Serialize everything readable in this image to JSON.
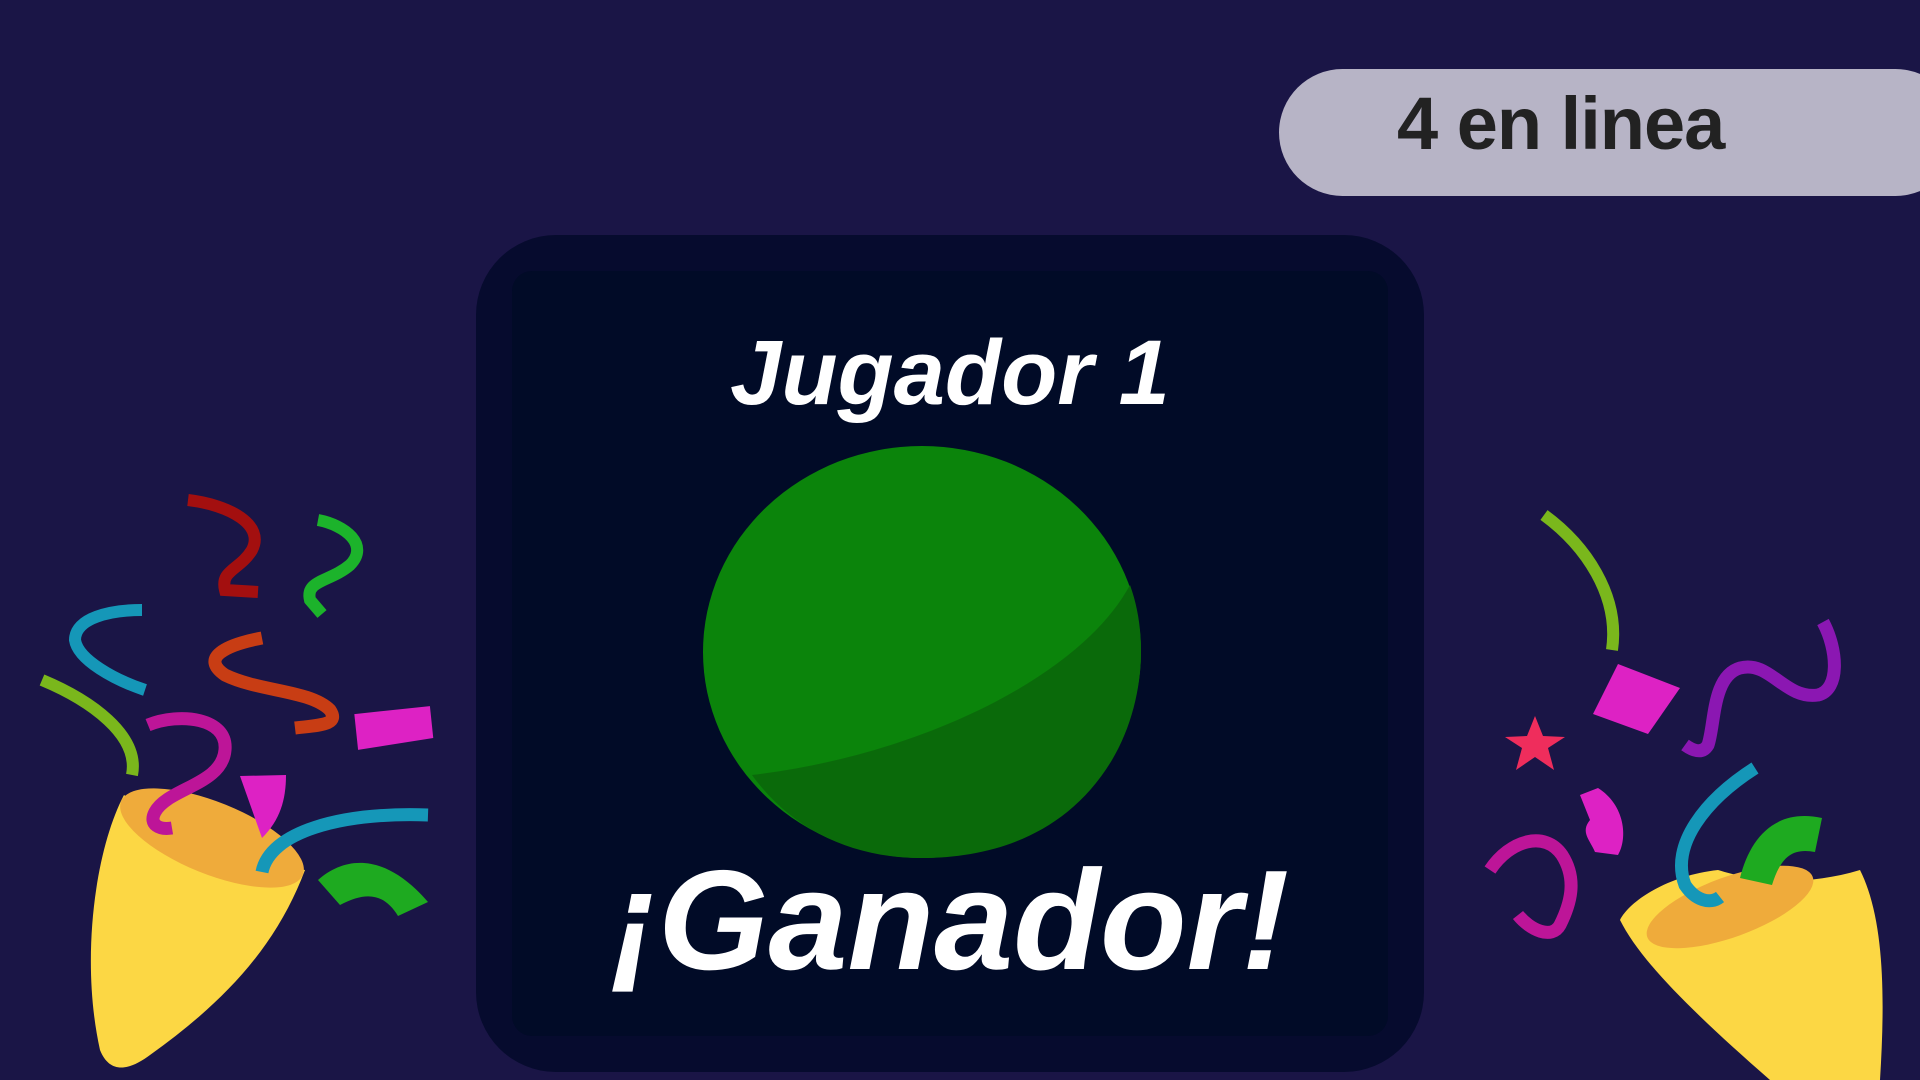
{
  "game": {
    "title": "4 en linea",
    "winner_player": "Jugador 1",
    "result_text": "¡Ganador!",
    "winner_piece_color": "#0b840b",
    "winner_piece_shade": "#0a6a0a"
  },
  "colors": {
    "background": "#1a1546",
    "title_pill": "#b7b4c6",
    "card": "#010b27"
  },
  "decorations": {
    "left_icon": "party-popper-icon",
    "right_icon": "party-popper-icon"
  }
}
